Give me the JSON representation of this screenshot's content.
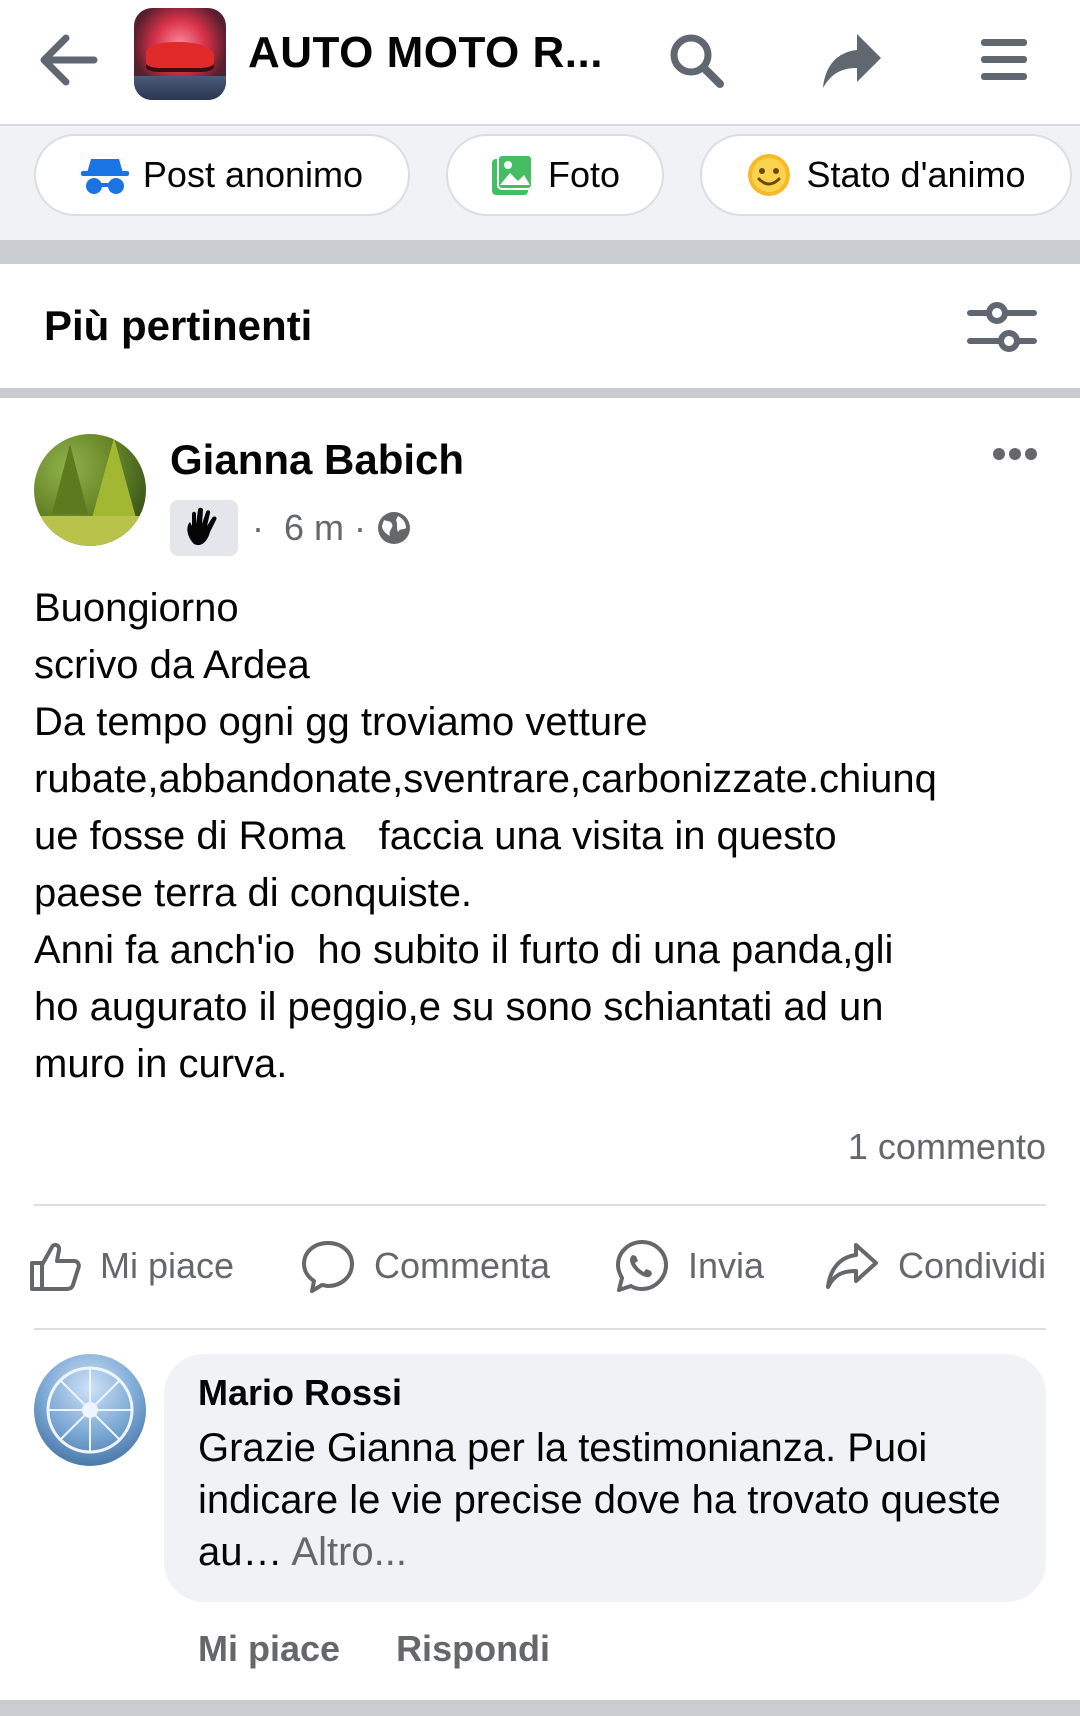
{
  "header": {
    "title": "AUTO MOTO R...",
    "icons": [
      "back-arrow-icon",
      "group-thumbnail",
      "search-icon",
      "share-icon",
      "menu-icon"
    ]
  },
  "composer": {
    "anonymous_label": "Post anonimo",
    "photo_label": "Foto",
    "mood_label": "Stato d'animo"
  },
  "sort": {
    "label": "Più pertinenti"
  },
  "post": {
    "author": "Gianna Babich",
    "time": "6 m",
    "separator": "·",
    "lines": [
      "Buongiorno",
      "scrivo da Ardea",
      "Da tempo ogni gg troviamo vetture",
      "rubate,abbandonate,sventrare,carbonizzate.chiunq",
      "ue fosse di Roma   faccia una visita in questo",
      "paese terra di conquiste.",
      "Anni fa anch'io  ho subito il furto di una panda,gli",
      "ho augurato il peggio,e su sono schiantati ad un",
      "muro in curva."
    ],
    "comment_count": "1 commento",
    "actions": {
      "like": "Mi piace",
      "comment": "Commenta",
      "send": "Invia",
      "share": "Condividi"
    }
  },
  "comment": {
    "author": "Mario Rossi",
    "text": "Grazie Gianna per la testimonianza. Puoi indicare le vie precise dove ha trovato queste au…",
    "more": " Altro...",
    "like": "Mi piace",
    "reply": "Rispondi"
  },
  "colors": {
    "text": "#050505",
    "secondary": "#65676b",
    "divider": "#c9ccd1",
    "bubble": "#f0f2f5",
    "anon_blue": "#1b74e4",
    "photo_green": "#45bd62",
    "mood_yellow": "#f7b928"
  }
}
